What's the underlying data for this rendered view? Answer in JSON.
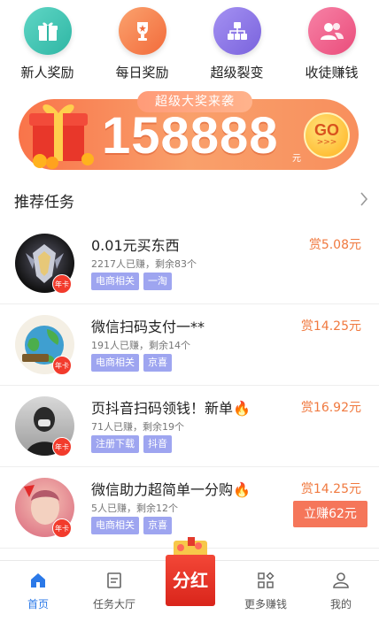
{
  "quick": [
    {
      "label": "新人奖励",
      "icon": "gift-icon",
      "color": "#3cc3b1"
    },
    {
      "label": "每日奖励",
      "icon": "trophy-icon",
      "color": "#f6844f"
    },
    {
      "label": "超级裂变",
      "icon": "network-icon",
      "color": "#8b77e6"
    },
    {
      "label": "收徒赚钱",
      "icon": "users-icon",
      "color": "#f0608b"
    }
  ],
  "banner": {
    "pill": "超级大奖来袭",
    "amount": "158888",
    "unit": "元",
    "go": "GO",
    "go_arrows": ">>>"
  },
  "section": {
    "title": "推荐任务"
  },
  "tasks": [
    {
      "title": "0.01元买东西",
      "stats": "2217人已赚，剩余83个",
      "tags": [
        "电商相关",
        "一淘"
      ],
      "reward": "赏5.08元",
      "badge": "年卡"
    },
    {
      "title": "微信扫码支付一**",
      "stats": "191人已赚，剩余14个",
      "tags": [
        "电商相关",
        "京喜"
      ],
      "reward": "赏14.25元",
      "badge": "年卡"
    },
    {
      "title": "页抖音扫码领钱！新单🔥",
      "stats": "71人已赚，剩余19个",
      "tags": [
        "注册下载",
        "抖音"
      ],
      "reward": "赏16.92元",
      "badge": "年卡"
    },
    {
      "title": "微信助力超简单一分购🔥",
      "stats": "5人已赚，剩余12个",
      "tags": [
        "电商相关",
        "京喜"
      ],
      "reward": "赏14.25元",
      "badge": "年卡",
      "button": "立赚62元"
    }
  ],
  "nav": [
    {
      "label": "首页",
      "icon": "home-icon",
      "active": true
    },
    {
      "label": "任务大厅",
      "icon": "task-list-icon"
    },
    {
      "label": "更多赚钱",
      "icon": "grid-icon"
    },
    {
      "label": "我的",
      "icon": "profile-icon"
    }
  ],
  "fenhong": {
    "label": "分红"
  },
  "colors": {
    "accent": "#2b79e8",
    "reward": "#f0793f",
    "tag": "#9ea5f0"
  }
}
